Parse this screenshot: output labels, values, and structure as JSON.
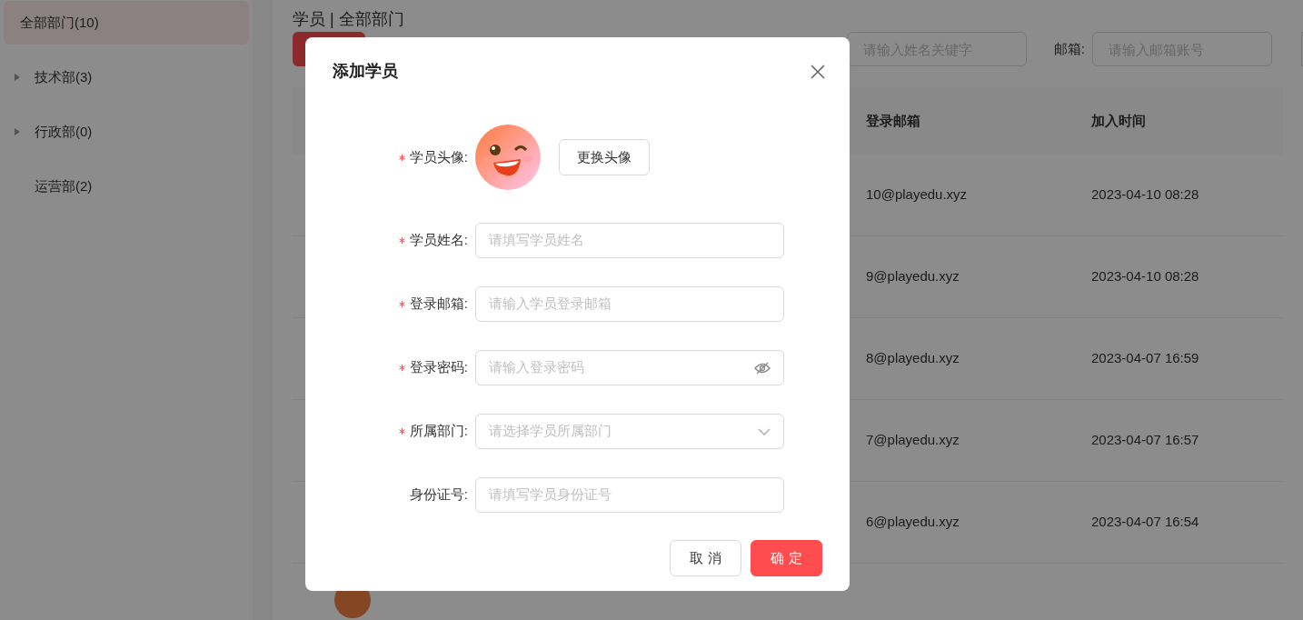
{
  "sidebar": {
    "items": [
      {
        "label": "全部部门(10)",
        "kind": "leaf",
        "selected": true
      },
      {
        "label": "技术部(3)",
        "kind": "group",
        "selected": false
      },
      {
        "label": "行政部(0)",
        "kind": "group",
        "selected": false
      },
      {
        "label": "运营部(2)",
        "kind": "leaf",
        "selected": false
      }
    ]
  },
  "page": {
    "breadcrumb": "学员 | 全部部门",
    "filters": [
      {
        "placeholder": "请输入姓名关键字"
      },
      {
        "label": "邮箱:",
        "placeholder": "请输入邮箱账号"
      }
    ],
    "table": {
      "columns": [
        "登录邮箱",
        "加入时间"
      ],
      "rows": [
        {
          "email": "10@playedu.xyz",
          "joined": "2023-04-10 08:28"
        },
        {
          "email": "9@playedu.xyz",
          "joined": "2023-04-10 08:28"
        },
        {
          "email": "8@playedu.xyz",
          "joined": "2023-04-07 16:59"
        },
        {
          "email": "7@playedu.xyz",
          "joined": "2023-04-07 16:57"
        },
        {
          "email": "6@playedu.xyz",
          "joined": "2023-04-07 16:54"
        }
      ]
    }
  },
  "dialog": {
    "title": "添加学员",
    "fields": [
      {
        "kind": "avatar",
        "label": "学员头像:",
        "required": true,
        "button_label": "更换头像"
      },
      {
        "kind": "text",
        "label": "学员姓名:",
        "required": true,
        "placeholder": "请填写学员姓名"
      },
      {
        "kind": "text",
        "label": "登录邮箱:",
        "required": true,
        "placeholder": "请输入学员登录邮箱"
      },
      {
        "kind": "password",
        "label": "登录密码:",
        "required": true,
        "placeholder": "请输入登录密码"
      },
      {
        "kind": "select",
        "label": "所属部门:",
        "required": true,
        "placeholder": "请选择学员所属部门"
      },
      {
        "kind": "text",
        "label": "身份证号:",
        "required": false,
        "placeholder": "请填写学员身份证号"
      }
    ],
    "buttons": [
      {
        "label": "取 消",
        "kind": "default"
      },
      {
        "label": "确 定",
        "kind": "primary"
      }
    ]
  }
}
